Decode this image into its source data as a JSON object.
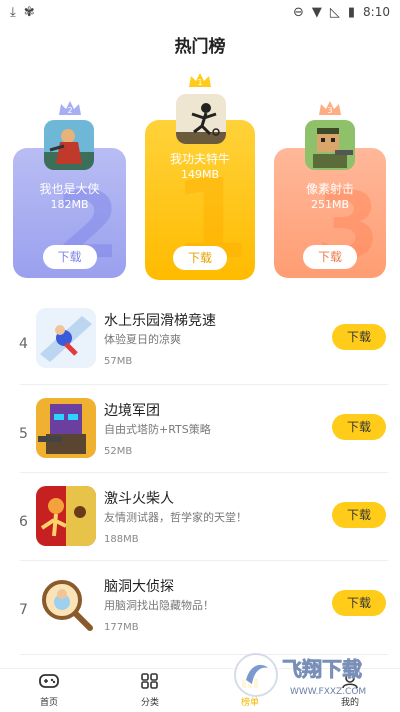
{
  "statusbar": {
    "time": "8:10"
  },
  "page": {
    "title": "热门榜"
  },
  "podium": {
    "first": {
      "rank": "1",
      "name": "我功夫特牛",
      "size": "149MB",
      "download_label": "下载"
    },
    "second": {
      "rank": "2",
      "name": "我也是大侠",
      "size": "182MB",
      "download_label": "下载"
    },
    "third": {
      "rank": "3",
      "name": "像素射击",
      "size": "251MB",
      "download_label": "下载"
    }
  },
  "list": [
    {
      "rank": "4",
      "name": "水上乐园滑梯竞速",
      "desc": "体验夏日的凉爽",
      "size": "57MB",
      "download_label": "下载"
    },
    {
      "rank": "5",
      "name": "边境军团",
      "desc": "自由式塔防+RTS策略",
      "size": "52MB",
      "download_label": "下载"
    },
    {
      "rank": "6",
      "name": "激斗火柴人",
      "desc": "友情测试器，哲学家的天堂！",
      "size": "188MB",
      "download_label": "下载"
    },
    {
      "rank": "7",
      "name": "脑洞大侦探",
      "desc": "用脑洞找出隐藏物品！",
      "size": "177MB",
      "download_label": "下载"
    }
  ],
  "nav": {
    "home": "首页",
    "category": "分类",
    "rank": "榜单",
    "mine": "我的"
  },
  "watermark": {
    "text": "飞翔下载",
    "url": "WWW.FXXZ.COM"
  },
  "colors": {
    "accent": "#ffcc1a",
    "second": "#9aa0ee",
    "third": "#ff9d73"
  }
}
